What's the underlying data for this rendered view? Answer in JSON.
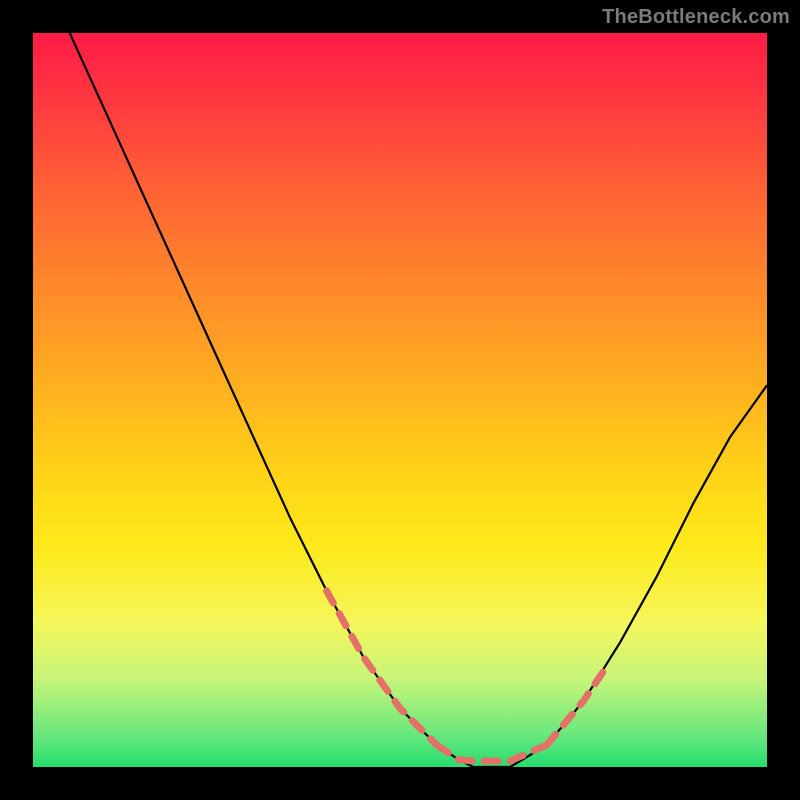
{
  "watermark": "TheBottleneck.com",
  "colors": {
    "frame": "#000000",
    "curve": "#000000",
    "dash": "#e37168",
    "gradient_top": "#ff1a46",
    "gradient_bottom": "#25dd6e"
  },
  "chart_data": {
    "type": "line",
    "title": "",
    "xlabel": "",
    "ylabel": "",
    "xlim": [
      0,
      100
    ],
    "ylim": [
      0,
      100
    ],
    "grid": false,
    "legend": false,
    "series": [
      {
        "name": "bottleneck-curve",
        "x": [
          5,
          10,
          15,
          20,
          25,
          30,
          35,
          40,
          45,
          50,
          55,
          58,
          60,
          62,
          65,
          70,
          75,
          80,
          85,
          90,
          95,
          100
        ],
        "y": [
          100,
          89,
          78,
          67,
          56,
          45,
          34,
          24,
          15,
          8,
          3,
          1,
          0,
          0,
          0,
          3,
          9,
          17,
          26,
          36,
          45,
          52
        ]
      }
    ],
    "annotations": [
      {
        "name": "dashed-threshold-left",
        "style": "dashed",
        "x_range": [
          40,
          55
        ],
        "note": "overlay on descending limb near valley"
      },
      {
        "name": "dashed-threshold-right",
        "style": "dashed",
        "x_range": [
          70,
          78
        ],
        "note": "overlay on ascending limb near valley"
      },
      {
        "name": "dashed-valley-floor",
        "style": "dashed",
        "x_range": [
          55,
          70
        ],
        "note": "flat floor of valley"
      }
    ]
  }
}
